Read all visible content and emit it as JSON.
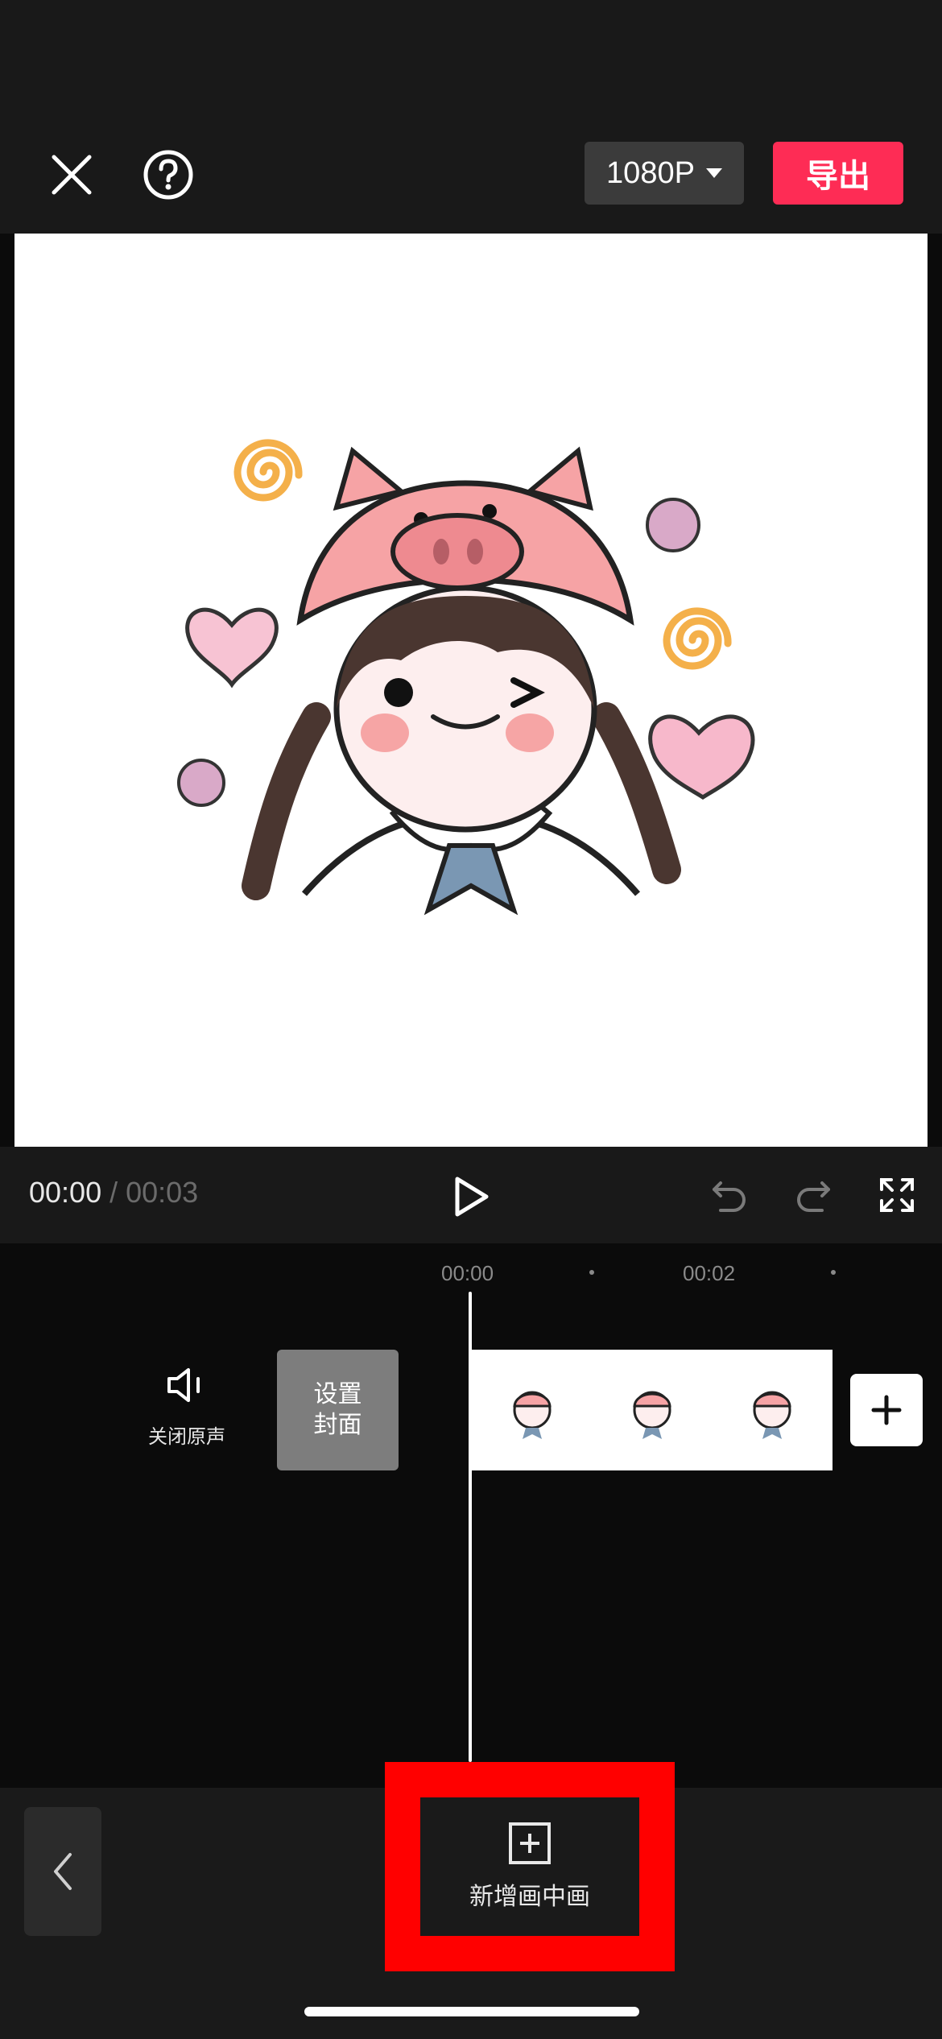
{
  "header": {
    "close_icon": "close-icon",
    "help_icon": "help-icon",
    "resolution_label": "1080P",
    "export_label": "导出",
    "accent_color": "#fe2c55"
  },
  "preview": {
    "image": "cartoon girl in pink pig hat with hearts and swirls"
  },
  "playback": {
    "current_time": "00:00",
    "separator": "/",
    "total_time": "00:03",
    "play_icon": "play-icon",
    "undo_icon": "undo-icon",
    "redo_icon": "redo-icon",
    "fullscreen_icon": "fullscreen-icon"
  },
  "timeline": {
    "ruler_labels": [
      "00:00",
      "00:02"
    ],
    "mute_label": "关闭原声",
    "cover_label_line1": "设置",
    "cover_label_line2": "封面",
    "add_clip_icon": "plus-icon"
  },
  "toolbar": {
    "back_icon": "chevron-left-icon",
    "pip_label": "新增画中画",
    "pip_icon": "add-square-icon"
  }
}
